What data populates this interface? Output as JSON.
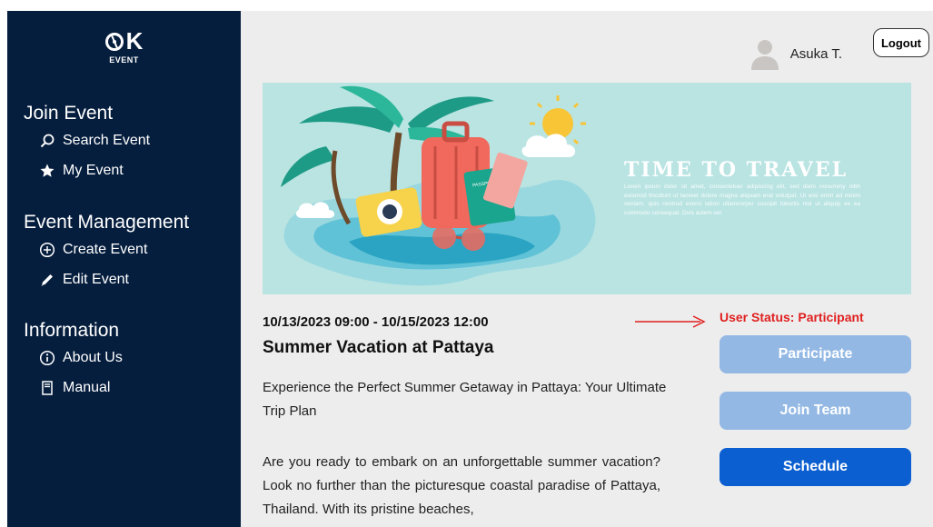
{
  "brand": {
    "logo_text": "K",
    "logo_sub": "EVENT"
  },
  "sidebar": {
    "sections": [
      {
        "heading": "Join Event",
        "items": [
          {
            "label": "Search Event",
            "icon": "search-icon"
          },
          {
            "label": "My Event",
            "icon": "star-icon"
          }
        ]
      },
      {
        "heading": "Event Management",
        "items": [
          {
            "label": "Create Event",
            "icon": "plus-circle-icon"
          },
          {
            "label": "Edit Event",
            "icon": "pencil-icon"
          }
        ]
      },
      {
        "heading": "Information",
        "items": [
          {
            "label": "About Us",
            "icon": "info-icon"
          },
          {
            "label": "Manual",
            "icon": "document-icon"
          }
        ]
      }
    ]
  },
  "header": {
    "user_name": "Asuka T.",
    "logout_label": "Logout"
  },
  "banner": {
    "title": "TIME TO TRAVEL",
    "body": "Lorem ipsum dolor sit amet, consectetuer adipiscing elit, sed diam nonummy nibh euismod tincidunt ut laoreet dolore magna aliquam erat volutpat. Ut wisi enim ad minim veniam, quis nostrud exerci tation ullamcorper suscipit lobortis nisl ut aliquip ex ea commodo consequat. Duis autem vel",
    "passport_text": "PASSPORT"
  },
  "event": {
    "date_range": "10/13/2023 09:00 - 10/15/2023 12:00",
    "title": "Summer Vacation at Pattaya",
    "subtitle": "Experience the Perfect Summer Getaway in Pattaya: Your Ultimate Trip Plan",
    "description": "Are you ready to embark on an unforgettable summer vacation? Look no further than the picturesque coastal paradise of Pattaya, Thailand. With its pristine beaches,"
  },
  "status": {
    "label": "User Status: Participant",
    "color": "#e02020"
  },
  "actions": {
    "participate": "Participate",
    "join_team": "Join Team",
    "schedule": "Schedule"
  },
  "colors": {
    "sidebar_bg": "#061e3e",
    "primary": "#0b5fd0",
    "disabled": "#93b8e4",
    "main_bg": "#ededed"
  }
}
